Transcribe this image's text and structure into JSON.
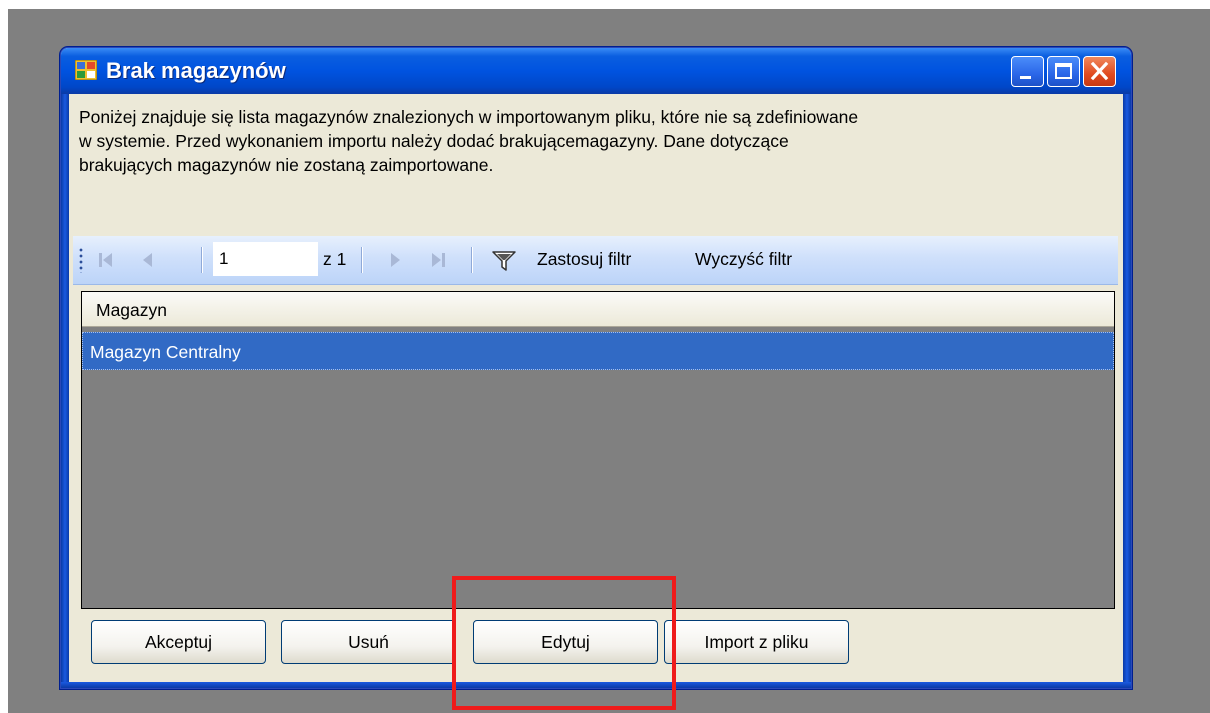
{
  "window": {
    "title": "Brak magazynów",
    "description": "Poniżej znajduje się lista magazynów znalezionych w importowanym pliku, które nie są zdefiniowane\nw systemie. Przed wykonaniem importu należy dodać brakującemagazyny. Dane dotyczące\nbrakujących magazynów nie zostaną zaimportowane."
  },
  "navigator": {
    "current_page": "1",
    "of_label": "z 1",
    "apply_filter_label": "Zastosuj filtr",
    "clear_filter_label": "Wyczyść filtr"
  },
  "grid": {
    "columns": [
      "Magazyn"
    ],
    "rows": [
      [
        "Magazyn Centralny"
      ]
    ]
  },
  "buttons": {
    "accept": "Akceptuj",
    "delete": "Usuń",
    "edit": "Edytuj",
    "import": "Import z pliku"
  },
  "colors": {
    "title_bar": "#0053e0",
    "selection": "#316ac5",
    "highlight_box": "#ef1b1b"
  },
  "icons": [
    "app-icon",
    "minimize-icon",
    "maximize-icon",
    "close-icon",
    "first-page-icon",
    "prev-page-icon",
    "next-page-icon",
    "last-page-icon",
    "filter-icon"
  ]
}
